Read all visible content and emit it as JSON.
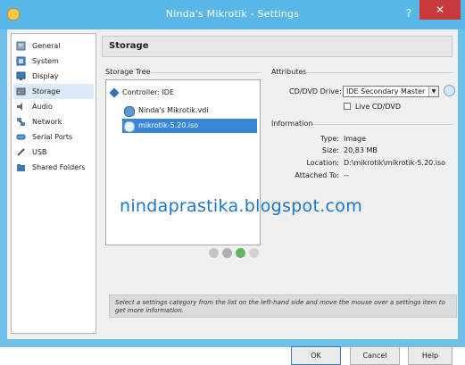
{
  "window": {
    "title": "Ninda's Mikrotik - Settings",
    "help_label": "?",
    "close_label": "✕"
  },
  "sidebar": {
    "items": [
      {
        "label": "General",
        "icon": "general-icon"
      },
      {
        "label": "System",
        "icon": "system-icon"
      },
      {
        "label": "Display",
        "icon": "display-icon"
      },
      {
        "label": "Storage",
        "icon": "storage-icon",
        "selected": true
      },
      {
        "label": "Audio",
        "icon": "audio-icon"
      },
      {
        "label": "Network",
        "icon": "network-icon"
      },
      {
        "label": "Serial Ports",
        "icon": "serial-ports-icon"
      },
      {
        "label": "USB",
        "icon": "usb-icon"
      },
      {
        "label": "Shared Folders",
        "icon": "shared-folders-icon"
      }
    ]
  },
  "page": {
    "title": "Storage"
  },
  "storage_tree": {
    "label": "Storage Tree",
    "controller": "Controller: IDE",
    "items": [
      {
        "label": "Ninda's Mikrotik.vdi",
        "type": "hard-disk"
      },
      {
        "label": "mikrotik-5.20.iso",
        "type": "optical-disk",
        "selected": true
      }
    ]
  },
  "attributes": {
    "label": "Attributes",
    "cd_dvd_drive_label": "CD/DVD Drive:",
    "cd_dvd_drive_value": "IDE Secondary Master",
    "live_cd_label": "Live CD/DVD",
    "live_cd_checked": false
  },
  "information": {
    "label": "Information",
    "type_label": "Type:",
    "type_value": "Image",
    "size_label": "Size:",
    "size_value": "20,83 MB",
    "location_label": "Location:",
    "location_value": "D:\\mikrotik\\mikrotik-5.20.iso",
    "attached_label": "Attached To:",
    "attached_value": "--"
  },
  "watermark": "nindaprastika.blogspot.com",
  "description": "Select a settings category from the list on the left-hand side and move the mouse over a settings item to get more information.",
  "buttons": {
    "ok": "OK",
    "cancel": "Cancel",
    "help": "Help"
  },
  "colors": {
    "titlebar": "#58b7e6",
    "selection": "#3a86d6",
    "close": "#c8393b",
    "watermark": "#1b77c9"
  }
}
